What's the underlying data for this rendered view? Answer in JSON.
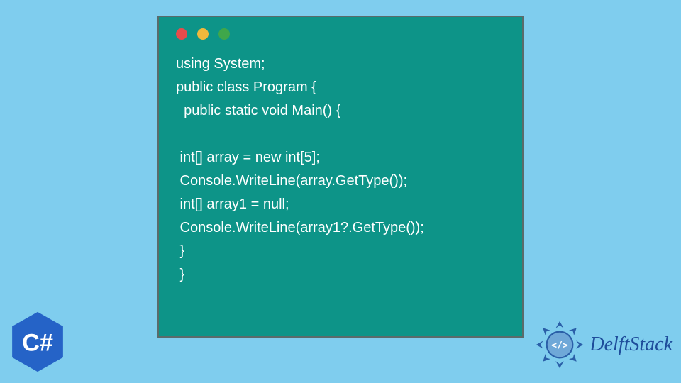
{
  "window": {
    "dots": [
      "red",
      "yellow",
      "green"
    ]
  },
  "code": {
    "lines": [
      "using System;",
      "public class Program {",
      "  public static void Main() {",
      "",
      " int[] array = new int[5];",
      " Console.WriteLine(array.GetType());",
      " int[] array1 = null;",
      " Console.WriteLine(array1?.GetType());",
      " }",
      " }"
    ]
  },
  "badges": {
    "csharp_label": "C#",
    "delftstack_label": "DelftStack"
  },
  "colors": {
    "page_bg": "#7fcdee",
    "window_bg": "#0d9488",
    "code_text": "#ffffff",
    "csharp_hex": "#2563c7",
    "delft_text": "#1e4d9b",
    "delft_logo": "#2a5fa8"
  }
}
